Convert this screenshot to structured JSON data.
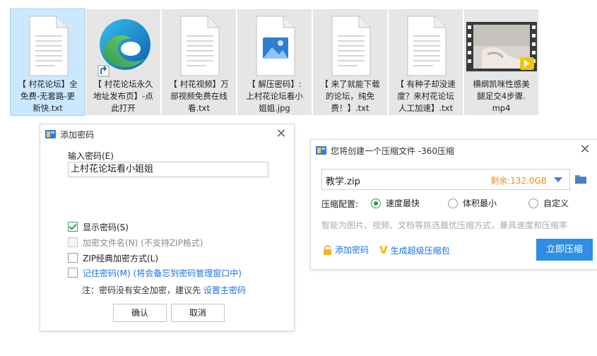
{
  "files": [
    {
      "name": "【 村花论坛】全\n免费-无套路-更\n新快.txt",
      "icon": "text-file-icon",
      "selected": true
    },
    {
      "name": "【 村花论坛永久\n地址发布页】-点\n此打开",
      "icon": "edge-shortcut-icon",
      "selected": false
    },
    {
      "name": "【 村花视频】万\n部视频免费在线\n看.txt",
      "icon": "text-file-icon",
      "selected": false
    },
    {
      "name": "【 解压密码】:\n上村花论坛看小\n姐姐.jpg",
      "icon": "image-file-icon",
      "selected": false
    },
    {
      "name": "【 来了就能下载\n的论坛，纯免\n费！】.txt",
      "icon": "text-file-icon",
      "selected": false
    },
    {
      "name": "【 有种子却没速\n度？来村花论坛\n人工加速】.txt",
      "icon": "text-file-icon",
      "selected": false
    },
    {
      "name": "横纲凯咪性感美\n腿足交4步骤.\nmp4",
      "icon": "video-thumbnail-icon",
      "selected": false
    }
  ],
  "password_dialog": {
    "title": "添加密码",
    "input_label": "输入密码(E)",
    "password_value": "上村花论坛看小姐姐",
    "show_password": "显示密码(S)",
    "encrypt_filenames": "加密文件名(N) (不支持ZIP格式)",
    "zip_classic": "ZIP经典加密方式(L)",
    "remember_password": "记住密码(M) (将会备忘到密码管理窗口中)",
    "note_prefix": "注：密码没有安全加密，建议先",
    "note_link": "设置主密码",
    "ok": "确认",
    "cancel": "取消"
  },
  "zip_dialog": {
    "title": "您将创建一个压缩文件 -360压缩",
    "filename": "教学.zip",
    "free_space": "剩余:132.0GB",
    "config_label": "压缩配置:",
    "options": [
      "速度最快",
      "体积最小",
      "自定义"
    ],
    "selected_option": "速度最快",
    "hint": "智能为图片、视频、文档等挑选最优压缩方式，兼具速度和压缩率",
    "add_password": "添加密码",
    "super_package": "生成超级压缩包",
    "compress_now": "立即压缩"
  },
  "colors": {
    "accent_blue": "#2f8de4",
    "free_space_orange": "#f08c1c",
    "check_green": "#2e9b4f",
    "link_blue": "#1a73e8",
    "super_gold": "#f5b800"
  }
}
